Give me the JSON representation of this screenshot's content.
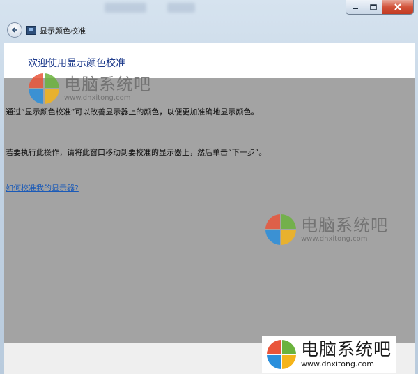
{
  "window": {
    "title": "显示颜色校准"
  },
  "content": {
    "heading": "欢迎使用显示颜色校准",
    "paragraphs": [
      "通过“显示颜色校准”可以改善显示器上的颜色，以便更加准确地显示颜色。",
      "若要执行此操作，请将此窗口移动到要校准的显示器上，然后单击“下一步”。"
    ],
    "help_link": "如何校准我的显示器?"
  },
  "watermark": {
    "brand": "电脑系统吧",
    "url": "www.dnxitong.com",
    "logo_colors": [
      "#e9553a",
      "#6bb33d",
      "#2a8fdc",
      "#f5b41a"
    ]
  },
  "icons": [
    "minimize-icon",
    "maximize-icon",
    "close-icon",
    "back-arrow-icon",
    "display-calibration-icon",
    "windows-logo-icon"
  ]
}
